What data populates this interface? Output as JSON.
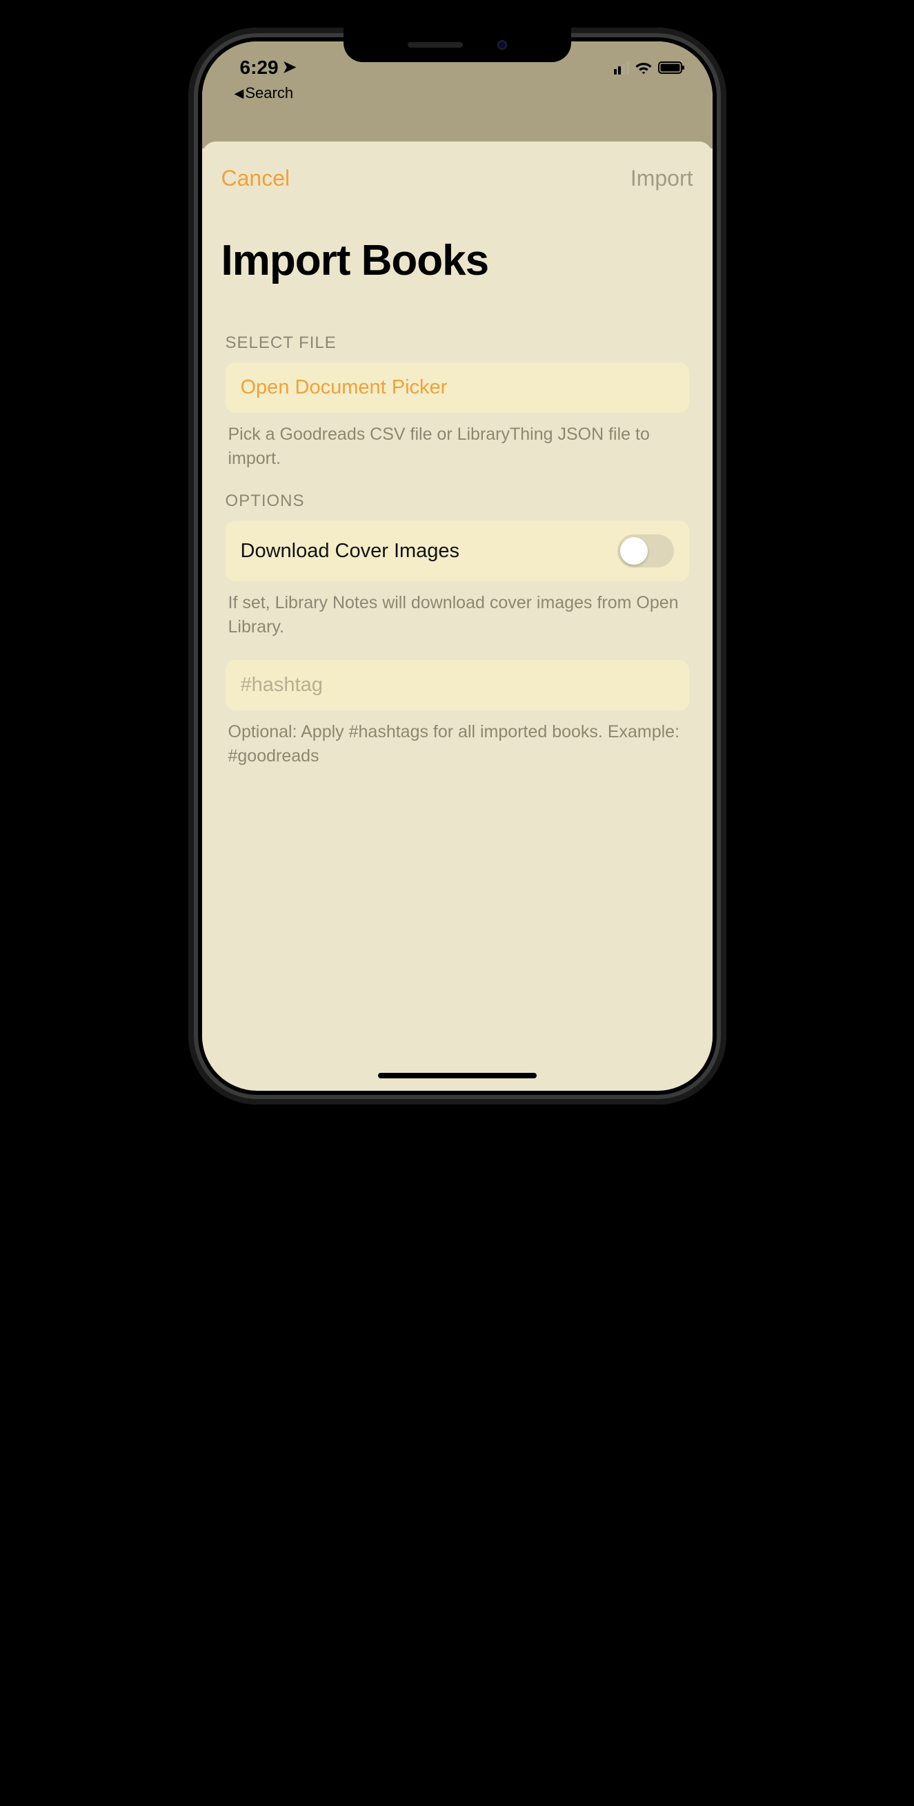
{
  "status": {
    "time": "6:29",
    "location_glyph": "➤",
    "back_label": "Search"
  },
  "nav": {
    "cancel": "Cancel",
    "import": "Import"
  },
  "title": "Import Books",
  "select_file": {
    "header": "SELECT FILE",
    "button": "Open Document Picker",
    "hint": "Pick a Goodreads CSV file or LibraryThing JSON file to import."
  },
  "options": {
    "header": "OPTIONS",
    "toggle_label": "Download Cover Images",
    "toggle_on": false,
    "hint": "If set, Library Notes will download cover images from Open Library."
  },
  "hashtag": {
    "placeholder": "#hashtag",
    "value": "",
    "hint": "Optional: Apply #hashtags for all imported books. Example: #goodreads"
  }
}
